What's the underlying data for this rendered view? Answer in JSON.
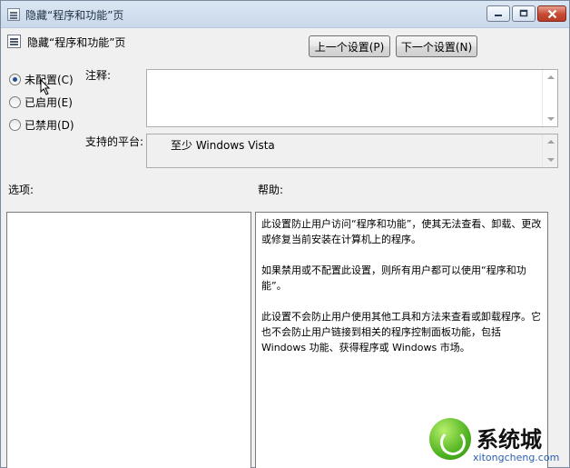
{
  "window": {
    "title": "隐藏“程序和功能”页",
    "controls": [
      "minimize-icon",
      "maximize-icon",
      "close-icon"
    ]
  },
  "header": {
    "title": "隐藏“程序和功能”页",
    "prev_button": "上一个设置(P)",
    "next_button": "下一个设置(N)"
  },
  "state": {
    "options": [
      {
        "label": "未配置(C)",
        "checked": true
      },
      {
        "label": "已启用(E)",
        "checked": false
      },
      {
        "label": "已禁用(D)",
        "checked": false
      }
    ]
  },
  "comment": {
    "label": "注释:",
    "value": ""
  },
  "platform": {
    "label": "支持的平台:",
    "value": "至少 Windows Vista"
  },
  "options_section": {
    "label": "选项:"
  },
  "help_section": {
    "label": "帮助:",
    "paragraphs": [
      "此设置防止用户访问“程序和功能”，使其无法查看、卸载、更改或修复当前安装在计算机上的程序。",
      "如果禁用或不配置此设置，则所有用户都可以使用“程序和功能”。",
      "此设置不会防止用户使用其他工具和方法来查看或卸载程序。它也不会防止用户链接到相关的程序控制面板功能，包括 Windows 功能、获得程序或 Windows 市场。"
    ]
  },
  "watermark": {
    "text_main": "系统城",
    "url": "xitongcheng.com"
  },
  "colors": {
    "titlebar": "#c9d8ea",
    "close": "#c74a33",
    "radio_dot": "#1f4f91",
    "watermark_green": "#4fb320"
  }
}
